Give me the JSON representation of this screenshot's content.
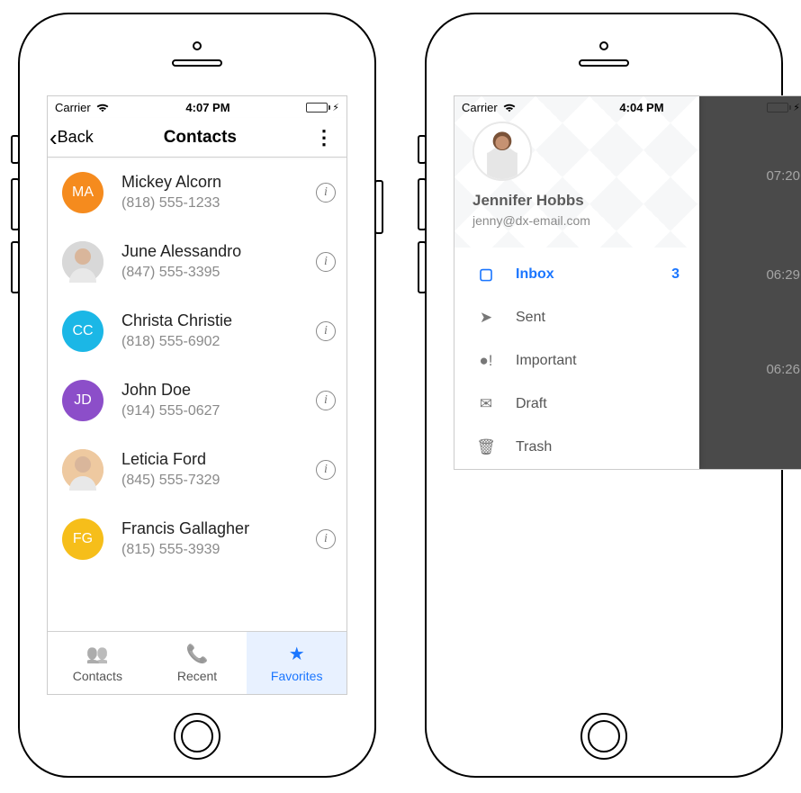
{
  "phone1": {
    "status": {
      "carrier": "Carrier",
      "time": "4:07 PM"
    },
    "nav": {
      "back": "Back",
      "title": "Contacts"
    },
    "contacts": [
      {
        "initials": "MA",
        "color": "#f58b1e",
        "photo": false,
        "name": "Mickey Alcorn",
        "phone": "(818) 555-1233"
      },
      {
        "initials": "",
        "color": "#d8d8d8",
        "photo": true,
        "name": "June Alessandro",
        "phone": "(847) 555-3395"
      },
      {
        "initials": "CC",
        "color": "#1bb7e6",
        "photo": false,
        "name": "Christa Christie",
        "phone": "(818) 555-6902"
      },
      {
        "initials": "JD",
        "color": "#8c4ec9",
        "photo": false,
        "name": "John Doe",
        "phone": "(914) 555-0627"
      },
      {
        "initials": "",
        "color": "#eec9a0",
        "photo": true,
        "name": "Leticia Ford",
        "phone": "(845) 555-7329"
      },
      {
        "initials": "FG",
        "color": "#f6be1a",
        "photo": false,
        "name": "Francis Gallagher",
        "phone": "(815) 555-3939"
      }
    ],
    "tabs": [
      {
        "icon": "people-icon",
        "glyph": "👥",
        "label": "Contacts",
        "active": false
      },
      {
        "icon": "phone-icon",
        "glyph": "📞",
        "label": "Recent",
        "active": false
      },
      {
        "icon": "star-icon",
        "glyph": "★",
        "label": "Favorites",
        "active": true
      }
    ]
  },
  "phone2": {
    "status": {
      "carrier": "Carrier",
      "time": "4:04 PM"
    },
    "user": {
      "name": "Jennifer Hobbs",
      "email": "jenny@dx-email.com"
    },
    "folders": [
      {
        "icon": "inbox-icon",
        "glyph": "▢",
        "name": "Inbox",
        "badge": "3",
        "active": true
      },
      {
        "icon": "sent-icon",
        "glyph": "➤",
        "name": "Sent",
        "badge": "",
        "active": false
      },
      {
        "icon": "important-icon",
        "glyph": "●!",
        "name": "Important",
        "badge": "",
        "active": false
      },
      {
        "icon": "draft-icon",
        "glyph": "✉",
        "name": "Draft",
        "badge": "",
        "active": false
      },
      {
        "icon": "trash-icon",
        "glyph": "🗑",
        "name": "Trash",
        "badge": "",
        "active": false
      }
    ],
    "dim_times": [
      "07:20",
      "06:29",
      "06:26"
    ]
  }
}
